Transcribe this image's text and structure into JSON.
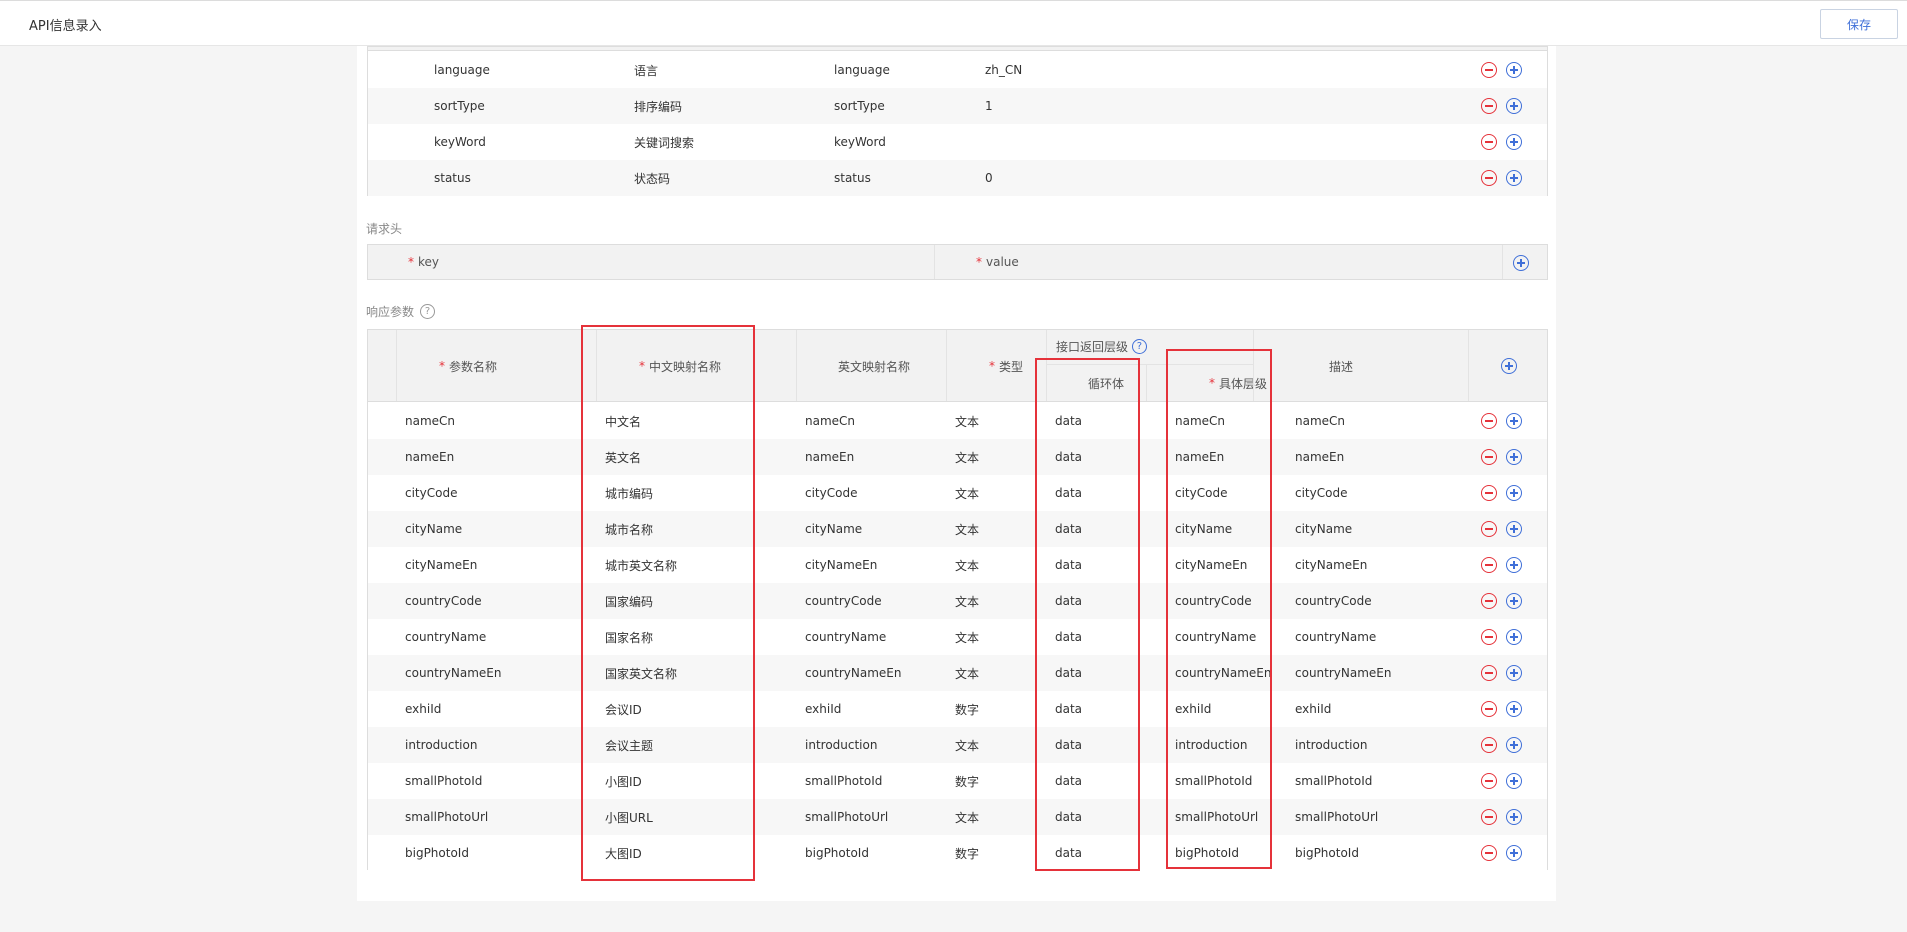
{
  "header": {
    "title": "API信息录入",
    "save_label": "保存"
  },
  "request_params": {
    "rows": [
      {
        "name": "language",
        "cn": "语言",
        "en": "language",
        "value": "zh_CN"
      },
      {
        "name": "sortType",
        "cn": "排序编码",
        "en": "sortType",
        "value": "1"
      },
      {
        "name": "keyWord",
        "cn": "关键词搜索",
        "en": "keyWord",
        "value": ""
      },
      {
        "name": "status",
        "cn": "状态码",
        "en": "status",
        "value": "0"
      }
    ]
  },
  "request_headers": {
    "label": "请求头",
    "key_header": "key",
    "value_header": "value"
  },
  "response_params": {
    "label": "响应参数",
    "help_glyph": "?",
    "columns": {
      "param_name": "参数名称",
      "cn_map": "中文映射名称",
      "en_map": "英文映射名称",
      "type": "类型",
      "level_group": "接口返回层级",
      "loop_body": "循环体",
      "level": "具体层级",
      "desc": "描述"
    },
    "rows": [
      {
        "name": "nameCn",
        "cn": "中文名",
        "en": "nameCn",
        "type": "文本",
        "loop": "data",
        "level": "nameCn",
        "desc": "nameCn"
      },
      {
        "name": "nameEn",
        "cn": "英文名",
        "en": "nameEn",
        "type": "文本",
        "loop": "data",
        "level": "nameEn",
        "desc": "nameEn"
      },
      {
        "name": "cityCode",
        "cn": "城市编码",
        "en": "cityCode",
        "type": "文本",
        "loop": "data",
        "level": "cityCode",
        "desc": "cityCode"
      },
      {
        "name": "cityName",
        "cn": "城市名称",
        "en": "cityName",
        "type": "文本",
        "loop": "data",
        "level": "cityName",
        "desc": "cityName"
      },
      {
        "name": "cityNameEn",
        "cn": "城市英文名称",
        "en": "cityNameEn",
        "type": "文本",
        "loop": "data",
        "level": "cityNameEn",
        "desc": "cityNameEn"
      },
      {
        "name": "countryCode",
        "cn": "国家编码",
        "en": "countryCode",
        "type": "文本",
        "loop": "data",
        "level": "countryCode",
        "desc": "countryCode"
      },
      {
        "name": "countryName",
        "cn": "国家名称",
        "en": "countryName",
        "type": "文本",
        "loop": "data",
        "level": "countryName",
        "desc": "countryName"
      },
      {
        "name": "countryNameEn",
        "cn": "国家英文名称",
        "en": "countryNameEn",
        "type": "文本",
        "loop": "data",
        "level": "countryNameEn",
        "desc": "countryNameEn"
      },
      {
        "name": "exhiId",
        "cn": "会议ID",
        "en": "exhiId",
        "type": "数字",
        "loop": "data",
        "level": "exhiId",
        "desc": "exhiId"
      },
      {
        "name": "introduction",
        "cn": "会议主题",
        "en": "introduction",
        "type": "文本",
        "loop": "data",
        "level": "introduction",
        "desc": "introduction"
      },
      {
        "name": "smallPhotoId",
        "cn": "小图ID",
        "en": "smallPhotoId",
        "type": "数字",
        "loop": "data",
        "level": "smallPhotoId",
        "desc": "smallPhotoId"
      },
      {
        "name": "smallPhotoUrl",
        "cn": "小图URL",
        "en": "smallPhotoUrl",
        "type": "文本",
        "loop": "data",
        "level": "smallPhotoUrl",
        "desc": "smallPhotoUrl"
      },
      {
        "name": "bigPhotoId",
        "cn": "大图ID",
        "en": "bigPhotoId",
        "type": "数字",
        "loop": "data",
        "level": "bigPhotoId",
        "desc": "bigPhotoId"
      }
    ]
  },
  "colors": {
    "accent": "#3f6fd8",
    "danger": "#e5323a",
    "stripe": "#f7f7f7"
  }
}
